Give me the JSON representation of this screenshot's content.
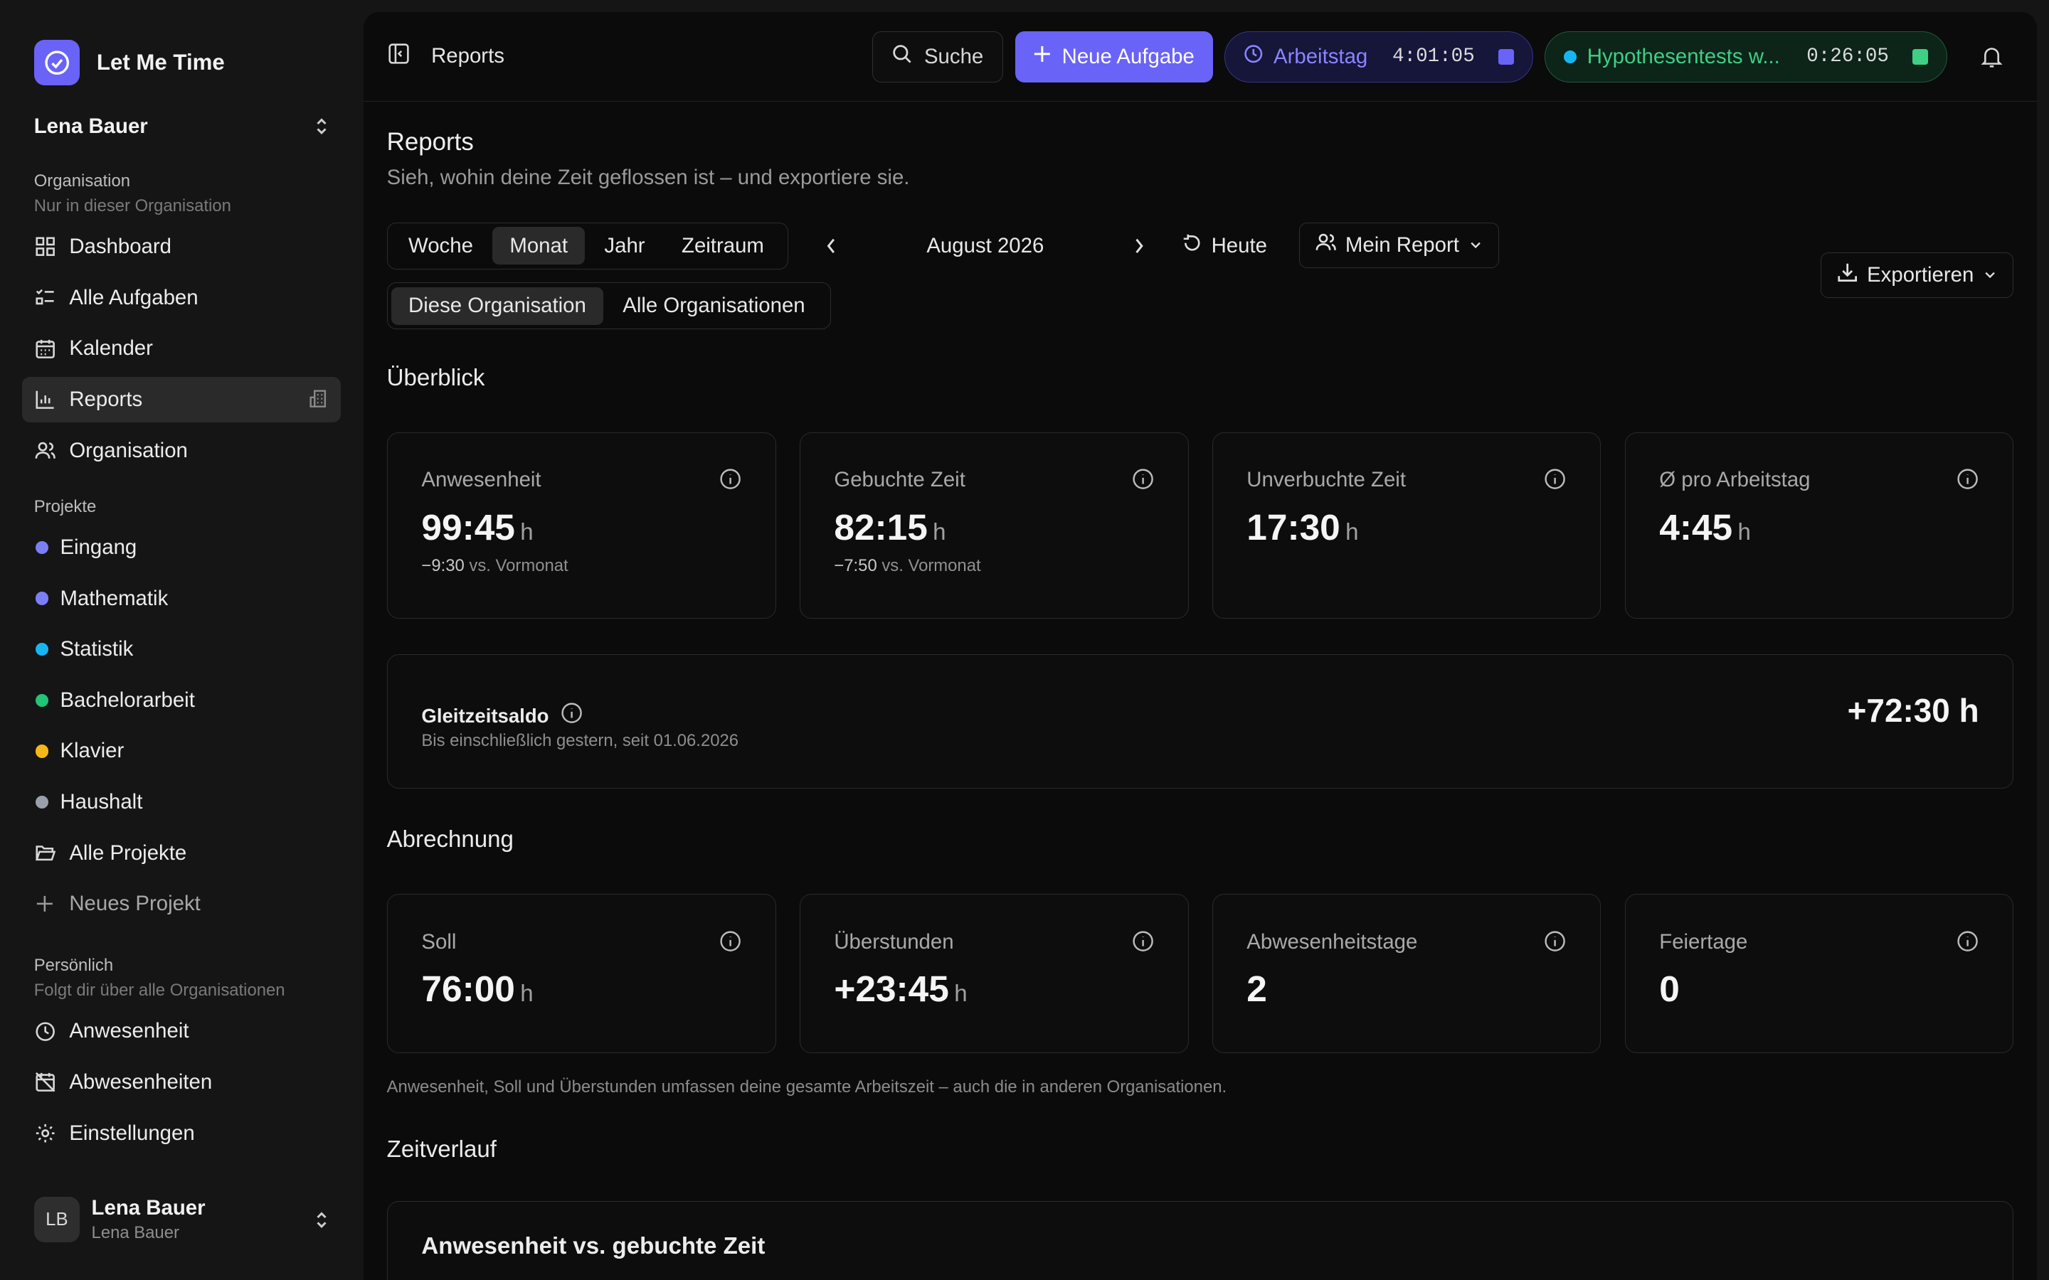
{
  "brand": {
    "name": "Let Me Time"
  },
  "user_switch": {
    "name": "Lena Bauer"
  },
  "sidebar": {
    "org_title": "Organisation",
    "org_sub": "Nur in dieser Organisation",
    "org_items": [
      "Dashboard",
      "Alle Aufgaben",
      "Kalender",
      "Reports",
      "Organisation"
    ],
    "projects_title": "Projekte",
    "projects": [
      {
        "label": "Eingang",
        "color": "#7b7ff5"
      },
      {
        "label": "Mathematik",
        "color": "#7b7ff5"
      },
      {
        "label": "Statistik",
        "color": "#17b6f0"
      },
      {
        "label": "Bachelorarbeit",
        "color": "#22c476"
      },
      {
        "label": "Klavier",
        "color": "#f5b619"
      },
      {
        "label": "Haushalt",
        "color": "#9aa0ab"
      }
    ],
    "all_projects": "Alle Projekte",
    "new_project": "Neues Projekt",
    "personal_title": "Persönlich",
    "personal_sub": "Folgt dir über alle Organisationen",
    "personal_items": [
      "Anwesenheit",
      "Abwesenheiten",
      "Einstellungen"
    ]
  },
  "profile": {
    "initials": "LB",
    "name": "Lena Bauer",
    "sub": "Lena Bauer"
  },
  "topbar": {
    "crumb": "Reports",
    "search": "Suche",
    "new_task": "Neue Aufgabe",
    "work_label": "Arbeitstag",
    "work_time": "4:01:05",
    "task_label": "Hypothesentests w...",
    "task_time": "0:26:05"
  },
  "colors": {
    "accent": "#6a63f7",
    "task": "#3fcf85",
    "work": "#8a85ff"
  },
  "page": {
    "title": "Reports",
    "subtitle": "Sieh, wohin deine Zeit geflossen ist – und exportiere sie."
  },
  "filters": {
    "periods": [
      "Woche",
      "Monat",
      "Jahr",
      "Zeitraum"
    ],
    "period_selected": "Monat",
    "scopes": [
      "Diese Organisation",
      "Alle Organisationen"
    ],
    "scope_selected": "Diese Organisation",
    "current_period": "August 2026",
    "today": "Heute",
    "report": "Mein Report",
    "export": "Exportieren"
  },
  "overview": {
    "title": "Überblick",
    "cards": [
      {
        "label": "Anwesenheit",
        "value": "99:45",
        "unit": "h",
        "delta": "−9:30",
        "delta_text": "vs. Vormonat"
      },
      {
        "label": "Gebuchte Zeit",
        "value": "82:15",
        "unit": "h",
        "delta": "−7:50",
        "delta_text": "vs. Vormonat"
      },
      {
        "label": "Unverbuchte Zeit",
        "value": "17:30",
        "unit": "h",
        "delta": "",
        "delta_text": ""
      },
      {
        "label": "Ø pro Arbeitstag",
        "value": "4:45",
        "unit": "h",
        "delta": "",
        "delta_text": ""
      }
    ]
  },
  "flex": {
    "label": "Gleitzeitsaldo",
    "sub": "Bis einschließlich gestern, seit 01.06.2026",
    "value": "+72:30 h"
  },
  "billing": {
    "title": "Abrechnung",
    "cards": [
      {
        "label": "Soll",
        "value": "76:00",
        "unit": "h"
      },
      {
        "label": "Überstunden",
        "value": "+23:45",
        "unit": "h"
      },
      {
        "label": "Abwesenheitstage",
        "value": "2",
        "unit": ""
      },
      {
        "label": "Feiertage",
        "value": "0",
        "unit": ""
      }
    ],
    "note": "Anwesenheit, Soll und Überstunden umfassen deine gesamte Arbeitszeit – auch die in anderen Organisationen."
  },
  "timeline": {
    "title": "Zeitverlauf",
    "card_title": "Anwesenheit vs. gebuchte Zeit"
  }
}
